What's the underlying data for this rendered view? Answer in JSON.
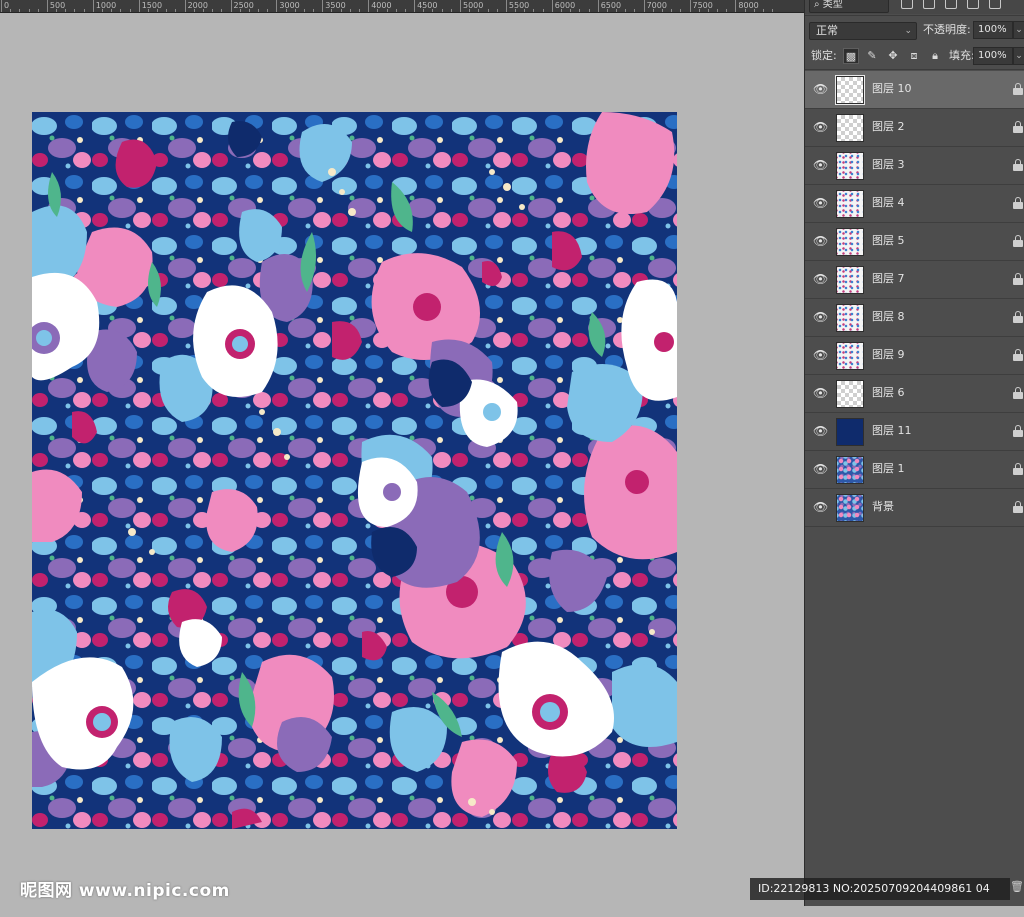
{
  "ruler": {
    "ticks": [
      "0",
      "500",
      "1000",
      "1500",
      "2000",
      "2500",
      "3000",
      "3500",
      "4000",
      "4500",
      "5000",
      "5500",
      "6000",
      "6500",
      "7000",
      "7500",
      "8000"
    ]
  },
  "layers_panel": {
    "filter": {
      "label": "类型"
    },
    "blend_mode": "正常",
    "opacity_label": "不透明度:",
    "opacity_value": "100%",
    "lock_label": "锁定:",
    "fill_label": "填充:",
    "fill_value": "100%",
    "layers": [
      {
        "name": "图层 10",
        "thumb": "checker",
        "selected": true
      },
      {
        "name": "图层 2",
        "thumb": "checker",
        "selected": false
      },
      {
        "name": "图层 3",
        "thumb": "speck",
        "selected": false
      },
      {
        "name": "图层 4",
        "thumb": "speck",
        "selected": false
      },
      {
        "name": "图层 5",
        "thumb": "speck",
        "selected": false
      },
      {
        "name": "图层 7",
        "thumb": "speck",
        "selected": false
      },
      {
        "name": "图层 8",
        "thumb": "speck",
        "selected": false
      },
      {
        "name": "图层 9",
        "thumb": "speck",
        "selected": false
      },
      {
        "name": "图层 6",
        "thumb": "checker",
        "selected": false
      },
      {
        "name": "图层 11",
        "thumb": "navy",
        "selected": false
      },
      {
        "name": "图层 1",
        "thumb": "full",
        "selected": false
      },
      {
        "name": "背景",
        "thumb": "full",
        "selected": false
      }
    ]
  },
  "status_bar": "ID:22129813 NO:20250709204409861 04",
  "watermark": "昵图网 www.nipic.com",
  "colors": {
    "panel_bg": "#4d4d4d",
    "selected_layer": "#696969",
    "canvas_bg": "#b6b6b6",
    "artboard_navy": "#0f2b6c",
    "flower_pink": "#f08bbf",
    "flower_magenta": "#c2226e",
    "flower_sky": "#7ec3e8",
    "flower_blue": "#2a6fc4",
    "flower_lilac": "#8b6bb8",
    "flower_green": "#4fb58c"
  }
}
